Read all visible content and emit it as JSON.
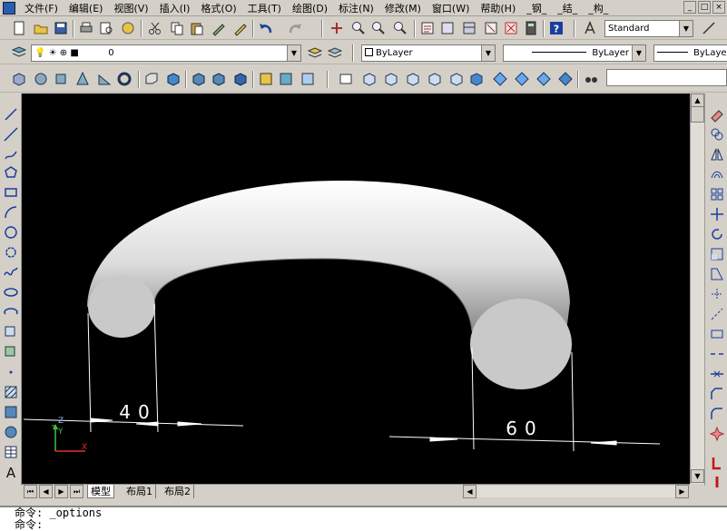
{
  "menubar": {
    "items": [
      "文件(F)",
      "编辑(E)",
      "视图(V)",
      "插入(I)",
      "格式(O)",
      "工具(T)",
      "绘图(D)",
      "标注(N)",
      "修改(M)",
      "窗口(W)",
      "帮助(H)",
      "_钢_",
      "_结_",
      "_构_"
    ],
    "window_buttons": [
      "_",
      "□",
      "×"
    ]
  },
  "toolbar1": {
    "text_style": "Standard"
  },
  "toolbar2": {
    "layer": "0",
    "color": "ByLayer",
    "linetype": "ByLayer",
    "lineweight": "ByLayer"
  },
  "drawing": {
    "dim_left": "40",
    "dim_right": "60",
    "ucs_y": "Y",
    "ucs_x": "X",
    "ucs_z": "Z"
  },
  "tabs": [
    "模型",
    "布局1",
    "布局2"
  ],
  "command": {
    "line1": "命令: _options",
    "line2": "命令:"
  },
  "colors": {
    "canvas": "#000000",
    "chrome": "#d4d0c8",
    "accent": "#2a5db0"
  }
}
